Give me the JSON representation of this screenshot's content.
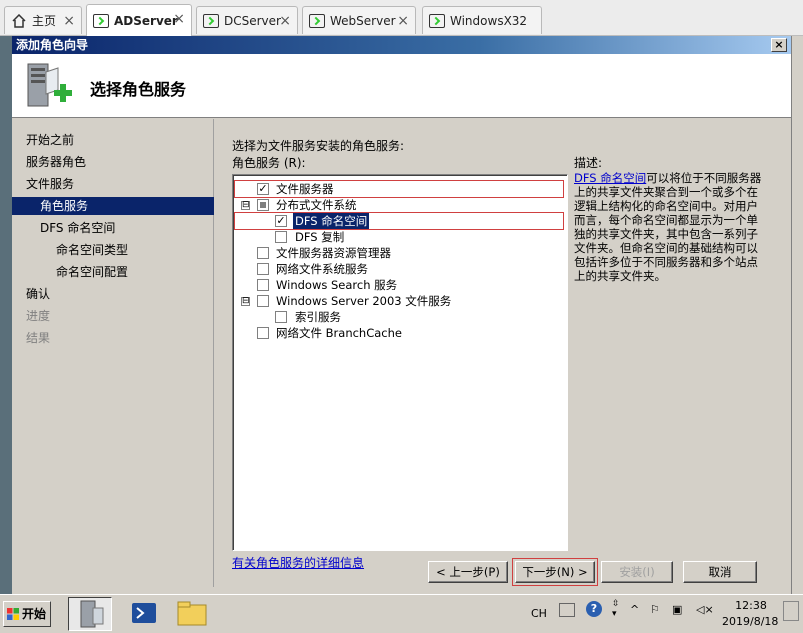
{
  "tabs": [
    {
      "label": "主页",
      "icon": "home-icon"
    },
    {
      "label": "ADServer",
      "icon": "vm-icon",
      "active": true
    },
    {
      "label": "DCServer",
      "icon": "vm-icon"
    },
    {
      "label": "WebServer",
      "icon": "vm-icon"
    },
    {
      "label": "WindowsX32",
      "icon": "vm-icon"
    }
  ],
  "window": {
    "title": "添加角色向导",
    "close": "×"
  },
  "header": {
    "title": "选择角色服务",
    "icon": "server-add-icon"
  },
  "nav": {
    "items": [
      {
        "label": "开始之前",
        "state": "normal"
      },
      {
        "label": "服务器角色",
        "state": "normal"
      },
      {
        "label": "文件服务",
        "state": "normal"
      },
      {
        "label": "角色服务",
        "state": "selected"
      },
      {
        "label": "DFS 命名空间",
        "state": "normal"
      },
      {
        "label": "命名空间类型",
        "state": "normal"
      },
      {
        "label": "命名空间配置",
        "state": "normal"
      },
      {
        "label": "确认",
        "state": "normal"
      },
      {
        "label": "进度",
        "state": "dim"
      },
      {
        "label": "结果",
        "state": "dim"
      }
    ]
  },
  "main": {
    "instruction": "选择为文件服务安装的角色服务:",
    "services_label": "角色服务 (R):",
    "description_label": "描述:",
    "description_link": "DFS 命名空间",
    "description_text": "可以将位于不同服务器上的共享文件夹聚合到一个或多个在逻辑上结构化的命名空间中。对用户而言，每个命名空间都显示为一个单独的共享文件夹，其中包含一系列子文件夹。但命名空间的基础结构可以包括许多位于不同服务器和多个站点上的共享文件夹。",
    "more_info_link": "有关角色服务的详细信息",
    "services": [
      {
        "label": "文件服务器",
        "checked": true
      },
      {
        "label": "分布式文件系统",
        "checked": "partial",
        "expander": "⊟"
      },
      {
        "label": "DFS 命名空间",
        "checked": true
      },
      {
        "label": "DFS 复制",
        "checked": false
      },
      {
        "label": "文件服务器资源管理器",
        "checked": false
      },
      {
        "label": "网络文件系统服务",
        "checked": false
      },
      {
        "label": "Windows Search 服务",
        "checked": false
      },
      {
        "label": "Windows Server 2003 文件服务",
        "checked": false,
        "expander": "⊟"
      },
      {
        "label": "索引服务",
        "checked": false
      },
      {
        "label": "网络文件 BranchCache",
        "checked": false
      }
    ],
    "check_mark": "✓"
  },
  "buttons": {
    "back": "< 上一步(P)",
    "next": "下一步(N) >",
    "install": "安装(I)",
    "cancel": "取消"
  },
  "taskbar": {
    "start": "开始",
    "ime": "CH",
    "time": "12:38",
    "date": "2019/8/18"
  }
}
